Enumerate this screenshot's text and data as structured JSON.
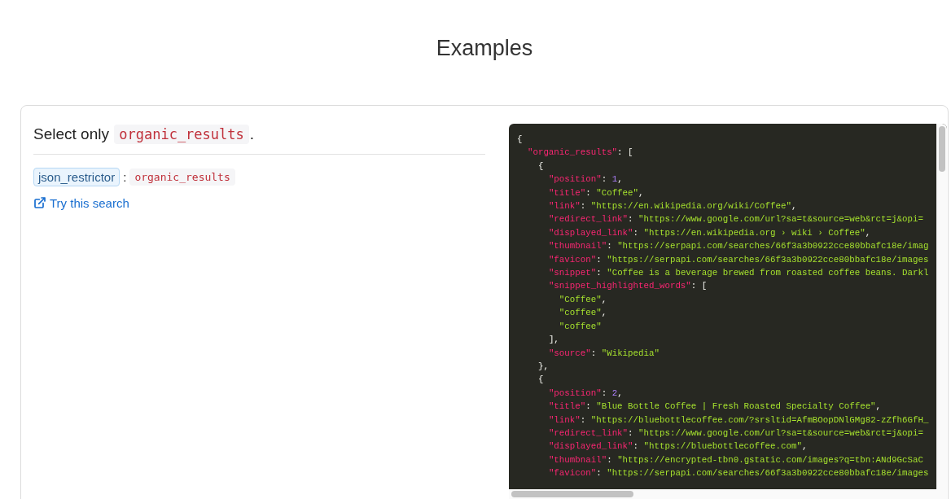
{
  "heading": "Examples",
  "example": {
    "description": [
      {
        "kind": "text",
        "text": "Select only"
      },
      {
        "kind": "code",
        "text": "organic_results"
      },
      {
        "kind": "text",
        "text": "."
      }
    ],
    "param_name": "json_restrictor",
    "param_separator": ":",
    "param_value": "organic_results",
    "link": "Try this search"
  },
  "code_lines": [
    [
      {
        "kind": "punct",
        "text": "{"
      }
    ],
    [
      {
        "kind": "key",
        "text": "\"organic_results\""
      },
      {
        "kind": "punct",
        "text": ": ["
      }
    ],
    [
      {
        "kind": "punct",
        "text": "{"
      }
    ],
    [
      {
        "kind": "key",
        "text": "\"position\""
      },
      {
        "kind": "punct",
        "text": ": "
      },
      {
        "kind": "number",
        "text": "1"
      },
      {
        "kind": "punct",
        "text": ","
      }
    ],
    [
      {
        "kind": "key",
        "text": "\"title\""
      },
      {
        "kind": "punct",
        "text": ": "
      },
      {
        "kind": "string",
        "text": "\"Coffee\""
      },
      {
        "kind": "punct",
        "text": ","
      }
    ],
    [
      {
        "kind": "key",
        "text": "\"link\""
      },
      {
        "kind": "punct",
        "text": ": "
      },
      {
        "kind": "string",
        "text": "\"https://en.wikipedia.org/wiki/Coffee\""
      },
      {
        "kind": "punct",
        "text": ","
      }
    ],
    [
      {
        "kind": "key",
        "text": "\"redirect_link\""
      },
      {
        "kind": "punct",
        "text": ": "
      },
      {
        "kind": "string",
        "text": "\"https://www.google.com/url?sa=t&source=web&rct=j&opi="
      }
    ],
    [
      {
        "kind": "key",
        "text": "\"displayed_link\""
      },
      {
        "kind": "punct",
        "text": ": "
      },
      {
        "kind": "string",
        "text": "\"https://en.wikipedia.org › wiki › Coffee\""
      },
      {
        "kind": "punct",
        "text": ","
      }
    ],
    [
      {
        "kind": "key",
        "text": "\"thumbnail\""
      },
      {
        "kind": "punct",
        "text": ": "
      },
      {
        "kind": "string",
        "text": "\"https://serpapi.com/searches/66f3a3b0922cce80bbafc18e/imag"
      }
    ],
    [
      {
        "kind": "key",
        "text": "\"favicon\""
      },
      {
        "kind": "punct",
        "text": ": "
      },
      {
        "kind": "string",
        "text": "\"https://serpapi.com/searches/66f3a3b0922cce80bbafc18e/images"
      }
    ],
    [
      {
        "kind": "key",
        "text": "\"snippet\""
      },
      {
        "kind": "punct",
        "text": ": "
      },
      {
        "kind": "string",
        "text": "\"Coffee is a beverage brewed from roasted coffee beans. Darkl"
      }
    ],
    [
      {
        "kind": "key",
        "text": "\"snippet_highlighted_words\""
      },
      {
        "kind": "punct",
        "text": ": ["
      }
    ],
    [
      {
        "kind": "string",
        "text": "\"Coffee\""
      },
      {
        "kind": "punct",
        "text": ","
      }
    ],
    [
      {
        "kind": "string",
        "text": "\"coffee\""
      },
      {
        "kind": "punct",
        "text": ","
      }
    ],
    [
      {
        "kind": "string",
        "text": "\"coffee\""
      }
    ],
    [
      {
        "kind": "punct",
        "text": "],"
      }
    ],
    [
      {
        "kind": "key",
        "text": "\"source\""
      },
      {
        "kind": "punct",
        "text": ": "
      },
      {
        "kind": "string",
        "text": "\"Wikipedia\""
      }
    ],
    [
      {
        "kind": "punct",
        "text": "},"
      }
    ],
    [
      {
        "kind": "punct",
        "text": "{"
      }
    ],
    [
      {
        "kind": "key",
        "text": "\"position\""
      },
      {
        "kind": "punct",
        "text": ": "
      },
      {
        "kind": "number",
        "text": "2"
      },
      {
        "kind": "punct",
        "text": ","
      }
    ],
    [
      {
        "kind": "key",
        "text": "\"title\""
      },
      {
        "kind": "punct",
        "text": ": "
      },
      {
        "kind": "string",
        "text": "\"Blue Bottle Coffee | Fresh Roasted Specialty Coffee\""
      },
      {
        "kind": "punct",
        "text": ","
      }
    ],
    [
      {
        "kind": "key",
        "text": "\"link\""
      },
      {
        "kind": "punct",
        "text": ": "
      },
      {
        "kind": "string",
        "text": "\"https://bluebottlecoffee.com/?srsltid=AfmBOopDNlGMg82-zZfh6GfH_"
      }
    ],
    [
      {
        "kind": "key",
        "text": "\"redirect_link\""
      },
      {
        "kind": "punct",
        "text": ": "
      },
      {
        "kind": "string",
        "text": "\"https://www.google.com/url?sa=t&source=web&rct=j&opi="
      }
    ],
    [
      {
        "kind": "key",
        "text": "\"displayed_link\""
      },
      {
        "kind": "punct",
        "text": ": "
      },
      {
        "kind": "string",
        "text": "\"https://bluebottlecoffee.com\""
      },
      {
        "kind": "punct",
        "text": ","
      }
    ],
    [
      {
        "kind": "key",
        "text": "\"thumbnail\""
      },
      {
        "kind": "punct",
        "text": ": "
      },
      {
        "kind": "string",
        "text": "\"https://encrypted-tbn0.gstatic.com/images?q=tbn:ANd9GcSaC"
      }
    ],
    [
      {
        "kind": "key",
        "text": "\"favicon\""
      },
      {
        "kind": "punct",
        "text": ": "
      },
      {
        "kind": "string",
        "text": "\"https://serpapi.com/searches/66f3a3b0922cce80bbafc18e/images"
      }
    ]
  ]
}
